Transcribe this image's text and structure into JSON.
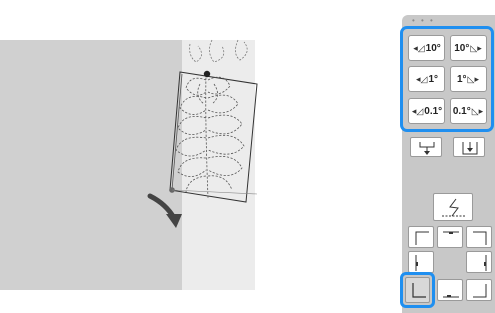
{
  "panel": {
    "header_text": "• • •",
    "rotation_buttons": [
      {
        "label": "10°",
        "icon": "rotate-left-icon",
        "direction": "left"
      },
      {
        "label": "10°",
        "icon": "rotate-right-icon",
        "direction": "right"
      },
      {
        "label": "1°",
        "icon": "rotate-left-icon",
        "direction": "left"
      },
      {
        "label": "1°",
        "icon": "rotate-right-icon",
        "direction": "right"
      },
      {
        "label": "0.1°",
        "icon": "rotate-left-icon",
        "direction": "left"
      },
      {
        "label": "0.1°",
        "icon": "rotate-right-icon",
        "direction": "right"
      }
    ],
    "accent_color": "#1f8ff0",
    "panel_color": "#c8c8c8"
  },
  "canvas": {
    "background_left": "#d0d0d0",
    "background_right": "#ececec",
    "rotate_arrow_color": "#444444"
  }
}
